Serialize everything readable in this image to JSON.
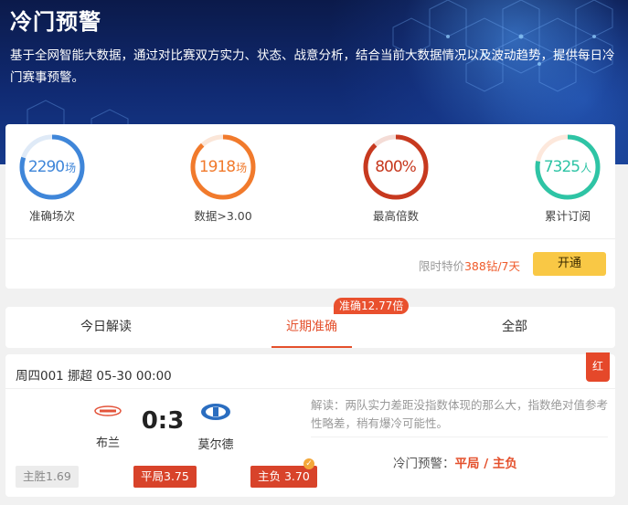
{
  "hero": {
    "title": "冷门预警",
    "description": "基于全网智能大数据，通过对比赛双方实力、状态、战意分析，结合当前大数据情况以及波动趋势，提供每日冷门赛事预警。"
  },
  "stats": [
    {
      "value": "2290",
      "unit": "场",
      "label": "准确场次",
      "color": "#3f86d9",
      "track": "#dfeaf7",
      "fill": 0.8
    },
    {
      "value": "1918",
      "unit": "场",
      "label": "数据>3.00",
      "color": "#f17a2c",
      "track": "#fbe6d8",
      "fill": 0.88
    },
    {
      "value": "800%",
      "unit": "",
      "label": "最高倍数",
      "color": "#c7391f",
      "track": "#f4dcd6",
      "fill": 0.88
    },
    {
      "value": "7325",
      "unit": "人",
      "label": "累计订阅",
      "color": "#2ec4a5",
      "track": "#fde8dc",
      "fill": 0.78
    }
  ],
  "promo": {
    "prefix": "限时特价",
    "price": "388钻/7天",
    "button": "开通"
  },
  "tabs": {
    "items": [
      "今日解读",
      "近期准确",
      "全部"
    ],
    "active": 1,
    "badge": "准确12.77倍"
  },
  "match": {
    "header": "周四001 挪超 05-30 00:00",
    "result_tag": "红",
    "home": {
      "name": "布兰"
    },
    "away": {
      "name": "莫尔德"
    },
    "score": "0:3",
    "analysis": "解读：两队实力差距没指数体现的那么大，指数绝对值参考性略差，稍有爆冷可能性。",
    "alert_label": "冷门预警：",
    "alert_pick": "平局 / 主负",
    "odds": [
      {
        "label": "主胜1.69",
        "highlight": false
      },
      {
        "label": "平局3.75",
        "highlight": true
      },
      {
        "label": "主负 3.70",
        "highlight": true
      }
    ],
    "corner_icon": "check-icon"
  },
  "colors": {
    "accent": "#e4502c",
    "button": "#f9c845"
  }
}
